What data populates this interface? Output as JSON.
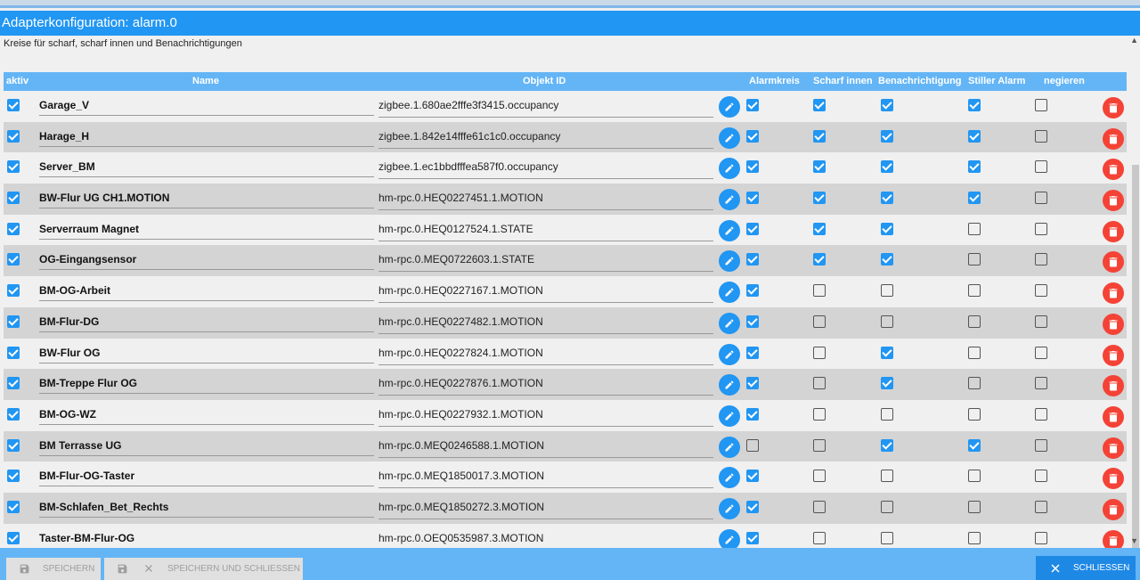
{
  "window": {
    "title": "Adapterkonfiguration: alarm.0",
    "subtitle": "Kreise für scharf, scharf innen und Benachrichtigungen"
  },
  "table": {
    "headers": {
      "aktiv": "aktiv",
      "name": "Name",
      "objekt_id": "Objekt ID",
      "alarmkreis": "Alarmkreis",
      "scharf_innen": "Scharf innen",
      "benachrichtigung": "Benachrichtigung",
      "stiller_alarm": "Stiller Alarm",
      "negieren": "negieren"
    },
    "rows": [
      {
        "aktiv": true,
        "name": "Garage_V",
        "id": "zigbee.1.680ae2fffe3f3415.occupancy",
        "alarmkreis": true,
        "scharf_innen": true,
        "benachrichtigung": true,
        "stiller_alarm": true,
        "negieren": false
      },
      {
        "aktiv": true,
        "name": "Harage_H",
        "id": "zigbee.1.842e14fffe61c1c0.occupancy",
        "alarmkreis": true,
        "scharf_innen": true,
        "benachrichtigung": true,
        "stiller_alarm": true,
        "negieren": false
      },
      {
        "aktiv": true,
        "name": "Server_BM",
        "id": "zigbee.1.ec1bbdfffea587f0.occupancy",
        "alarmkreis": true,
        "scharf_innen": true,
        "benachrichtigung": true,
        "stiller_alarm": true,
        "negieren": false
      },
      {
        "aktiv": true,
        "name": "BW-Flur UG CH1.MOTION",
        "id": "hm-rpc.0.HEQ0227451.1.MOTION",
        "alarmkreis": true,
        "scharf_innen": true,
        "benachrichtigung": true,
        "stiller_alarm": true,
        "negieren": false
      },
      {
        "aktiv": true,
        "name": "Serverraum Magnet",
        "id": "hm-rpc.0.HEQ0127524.1.STATE",
        "alarmkreis": true,
        "scharf_innen": true,
        "benachrichtigung": true,
        "stiller_alarm": false,
        "negieren": false
      },
      {
        "aktiv": true,
        "name": "OG-Eingangsensor",
        "id": "hm-rpc.0.MEQ0722603.1.STATE",
        "alarmkreis": true,
        "scharf_innen": true,
        "benachrichtigung": true,
        "stiller_alarm": false,
        "negieren": false
      },
      {
        "aktiv": true,
        "name": "BM-OG-Arbeit",
        "id": "hm-rpc.0.HEQ0227167.1.MOTION",
        "alarmkreis": true,
        "scharf_innen": false,
        "benachrichtigung": false,
        "stiller_alarm": false,
        "negieren": false
      },
      {
        "aktiv": true,
        "name": "BM-Flur-DG",
        "id": "hm-rpc.0.HEQ0227482.1.MOTION",
        "alarmkreis": true,
        "scharf_innen": false,
        "benachrichtigung": false,
        "stiller_alarm": false,
        "negieren": false
      },
      {
        "aktiv": true,
        "name": "BW-Flur OG",
        "id": "hm-rpc.0.HEQ0227824.1.MOTION",
        "alarmkreis": true,
        "scharf_innen": false,
        "benachrichtigung": true,
        "stiller_alarm": false,
        "negieren": false
      },
      {
        "aktiv": true,
        "name": "BM-Treppe Flur OG",
        "id": "hm-rpc.0.HEQ0227876.1.MOTION",
        "alarmkreis": true,
        "scharf_innen": false,
        "benachrichtigung": true,
        "stiller_alarm": false,
        "negieren": false
      },
      {
        "aktiv": true,
        "name": "BM-OG-WZ",
        "id": "hm-rpc.0.HEQ0227932.1.MOTION",
        "alarmkreis": true,
        "scharf_innen": false,
        "benachrichtigung": false,
        "stiller_alarm": false,
        "negieren": false
      },
      {
        "aktiv": true,
        "name": "BM Terrasse UG",
        "id": "hm-rpc.0.MEQ0246588.1.MOTION",
        "alarmkreis": false,
        "scharf_innen": false,
        "benachrichtigung": true,
        "stiller_alarm": true,
        "negieren": false
      },
      {
        "aktiv": true,
        "name": "BM-Flur-OG-Taster",
        "id": "hm-rpc.0.MEQ1850017.3.MOTION",
        "alarmkreis": true,
        "scharf_innen": false,
        "benachrichtigung": false,
        "stiller_alarm": false,
        "negieren": false
      },
      {
        "aktiv": true,
        "name": "BM-Schlafen_Bet_Rechts",
        "id": "hm-rpc.0.MEQ1850272.3.MOTION",
        "alarmkreis": true,
        "scharf_innen": false,
        "benachrichtigung": false,
        "stiller_alarm": false,
        "negieren": false
      },
      {
        "aktiv": true,
        "name": "Taster-BM-Flur-OG",
        "id": "hm-rpc.0.OEQ0535987.3.MOTION",
        "alarmkreis": true,
        "scharf_innen": false,
        "benachrichtigung": false,
        "stiller_alarm": false,
        "negieren": false
      }
    ]
  },
  "footer": {
    "save_label": "SPEICHERN",
    "save_close_label": "SPEICHERN UND SCHLIESSEN",
    "close_label": "SCHLIESSEN"
  },
  "icons": {
    "edit": "pencil-icon",
    "delete": "trash-icon",
    "save": "floppy-disk-icon",
    "close": "close-icon"
  },
  "colors": {
    "accent": "#2196f3",
    "header": "#64b5f6",
    "delete": "#f44336"
  }
}
